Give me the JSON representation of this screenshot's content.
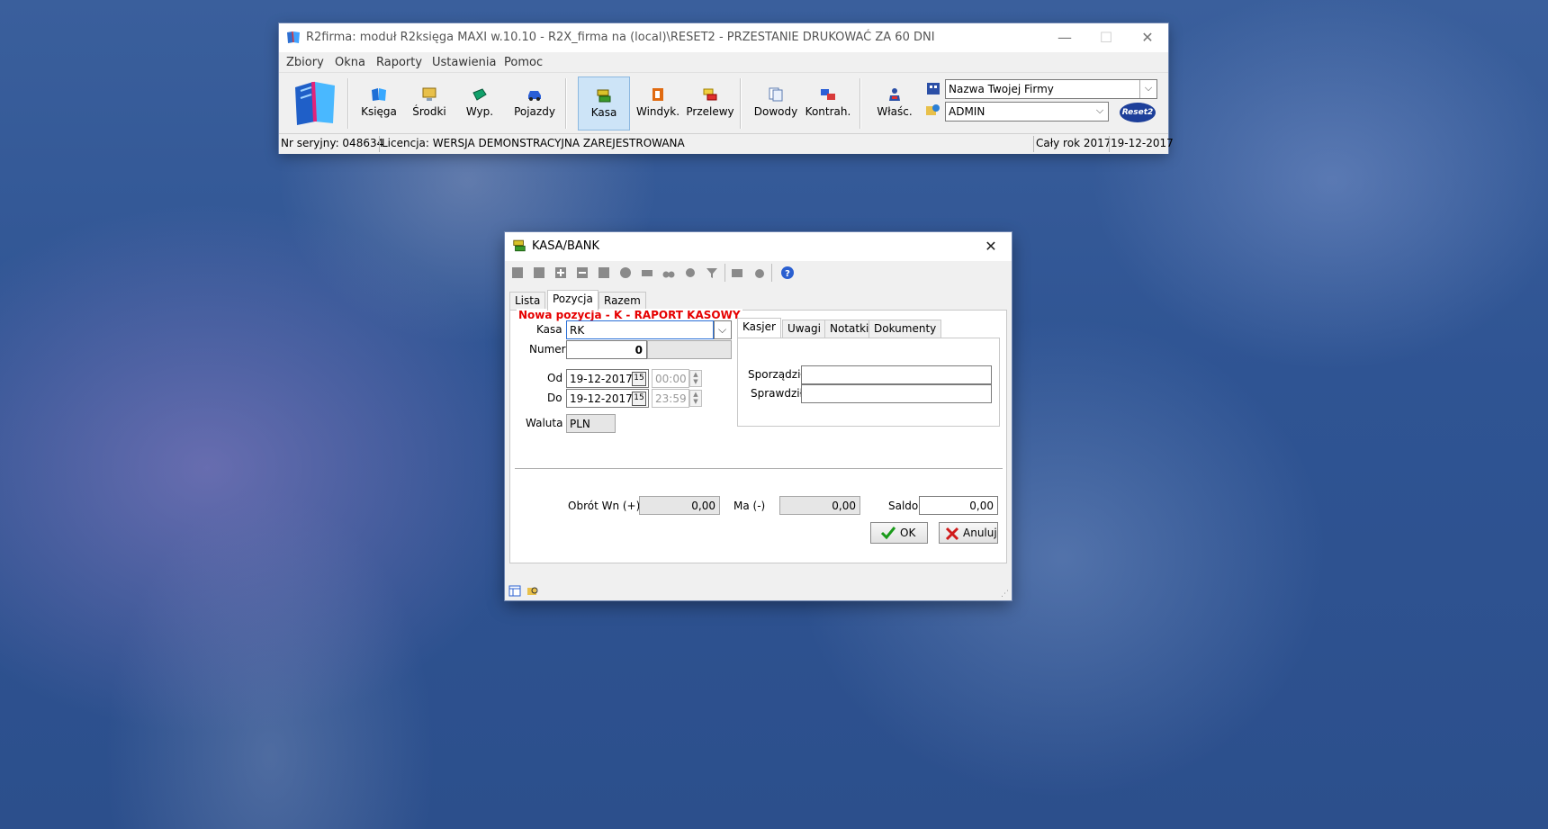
{
  "main_window": {
    "title": "R2firma: moduł R2księga MAXI w.10.10 - R2X_firma na (local)\\RESET2 - PRZESTANIE DRUKOWAĆ ZA 60 DNI",
    "window_controls": {
      "minimize": "—",
      "maximize": "☐",
      "close": "✕"
    },
    "menu": [
      "Zbiory",
      "Okna",
      "Raporty",
      "Ustawienia",
      "Pomoc"
    ],
    "toolbar": {
      "buttons": [
        {
          "label": "Księga",
          "icon": "book-icon"
        },
        {
          "label": "Środki",
          "icon": "monitor-icon"
        },
        {
          "label": "Wyp.",
          "icon": "equipment-icon"
        },
        {
          "label": "Pojazdy",
          "icon": "car-icon"
        },
        {
          "label": "Kasa",
          "icon": "cash-register-icon",
          "active": true
        },
        {
          "label": "Windyk.",
          "icon": "debt-collection-icon"
        },
        {
          "label": "Przelewy",
          "icon": "transfer-icon"
        },
        {
          "label": "Dowody",
          "icon": "documents-icon"
        },
        {
          "label": "Kontrah.",
          "icon": "contractors-icon"
        },
        {
          "label": "Właśc.",
          "icon": "owner-icon"
        }
      ],
      "company_select": "Nazwa Twojej Firmy",
      "user_select": "ADMIN",
      "logo_text": "Reset2"
    },
    "status": {
      "serial": "Nr seryjny: 048634",
      "license": "Licencja: WERSJA DEMONSTRACYJNA ZAREJESTROWANA",
      "period": "Cały rok 2017",
      "date": "19-12-2017"
    }
  },
  "dialog": {
    "title": "KASA/BANK",
    "close": "✕",
    "tabs": [
      "Lista",
      "Pozycja",
      "Razem"
    ],
    "selected_tab": "Pozycja",
    "heading": "Nowa pozycja - K - RAPORT KASOWY",
    "heading_color": "#e60000",
    "form": {
      "kasa_label": "Kasa",
      "kasa_value": "RK",
      "numer_label": "Numer",
      "numer_value": "0",
      "od_label": "Od",
      "od_date": "19-12-2017",
      "od_time": "00:00",
      "do_label": "Do",
      "do_date": "19-12-2017",
      "do_time": "23:59",
      "waluta_label": "Waluta",
      "waluta_value": "PLN",
      "calendar_glyph": "15"
    },
    "right_tabs": [
      "Kasjer",
      "Uwagi",
      "Notatki",
      "Dokumenty"
    ],
    "kasjer": {
      "sporzadzil_label": "Sporządził",
      "sporzadzil_value": "",
      "sprawdzil_label": "Sprawdził",
      "sprawdzil_value": ""
    },
    "totals": {
      "obrot_label": "Obrót Wn (+)",
      "obrot_value": "0,00",
      "ma_label": "Ma (-)",
      "ma_value": "0,00",
      "saldo_label": "Saldo",
      "saldo_value": "0,00"
    },
    "buttons": {
      "ok": "OK",
      "cancel": "Anuluj"
    }
  }
}
